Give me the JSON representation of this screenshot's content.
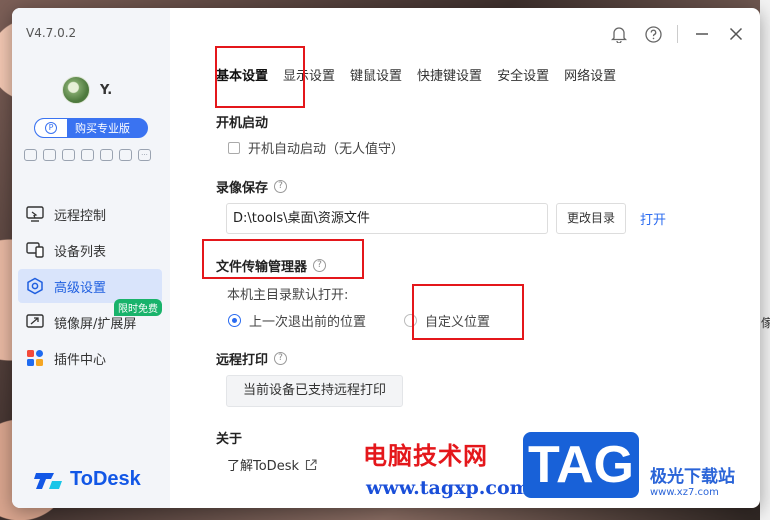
{
  "app": {
    "version": "V4.7.0.2",
    "username": "Y.",
    "pro_button": "购买专业版",
    "pro_icon_letter": "P",
    "logo_text": "ToDesk",
    "brand_color": "#1257e6",
    "accent_color": "#2a6bf0",
    "highlight_color": "#e4171b"
  },
  "sidebar": {
    "quick_icons": [
      "gamepad-icon",
      "monitor-icon",
      "window-icon",
      "screen-icon",
      "bulb-icon",
      "clock-icon",
      "more-icon"
    ],
    "items": [
      {
        "label": "远程控制",
        "icon": "remote-control-icon",
        "active": false
      },
      {
        "label": "设备列表",
        "icon": "devices-icon",
        "active": false
      },
      {
        "label": "高级设置",
        "icon": "settings-hexagon-icon",
        "active": true
      },
      {
        "label": "镜像屏/扩展屏",
        "icon": "mirror-screen-icon",
        "active": false,
        "badge": "限时免费"
      },
      {
        "label": "插件中心",
        "icon": "plugins-icon",
        "active": false
      }
    ]
  },
  "topbar": {
    "icons": [
      "bell-icon",
      "help-icon",
      "minimize-icon",
      "close-icon"
    ]
  },
  "tabs": [
    {
      "label": "基本设置",
      "active": true
    },
    {
      "label": "显示设置",
      "active": false
    },
    {
      "label": "键鼠设置",
      "active": false
    },
    {
      "label": "快捷键设置",
      "active": false
    },
    {
      "label": "安全设置",
      "active": false
    },
    {
      "label": "网络设置",
      "active": false
    }
  ],
  "startup": {
    "title": "开机启动",
    "checkbox_label": "开机自动启动（无人值守）",
    "checked": false
  },
  "recording": {
    "title": "录像保存",
    "path": "D:\\tools\\桌面\\资源文件",
    "change_button": "更改目录",
    "open_link": "打开"
  },
  "file_transfer": {
    "title": "文件传输管理器",
    "default_open_label": "本机主目录默认打开:",
    "options": [
      {
        "label": "上一次退出前的位置",
        "checked": true
      },
      {
        "label": "自定义位置",
        "checked": false
      }
    ]
  },
  "remote_print": {
    "title": "远程打印",
    "button": "当前设备已支持远程打印"
  },
  "about": {
    "title": "关于",
    "link": "了解ToDesk"
  },
  "watermark": {
    "cn_text": "电脑技术网",
    "url": "www.tagxp.com",
    "tag": "TAG",
    "site_cn": "极光下载站",
    "site_en": "www.xz7.com"
  },
  "background": {
    "edge_text": "傢"
  }
}
